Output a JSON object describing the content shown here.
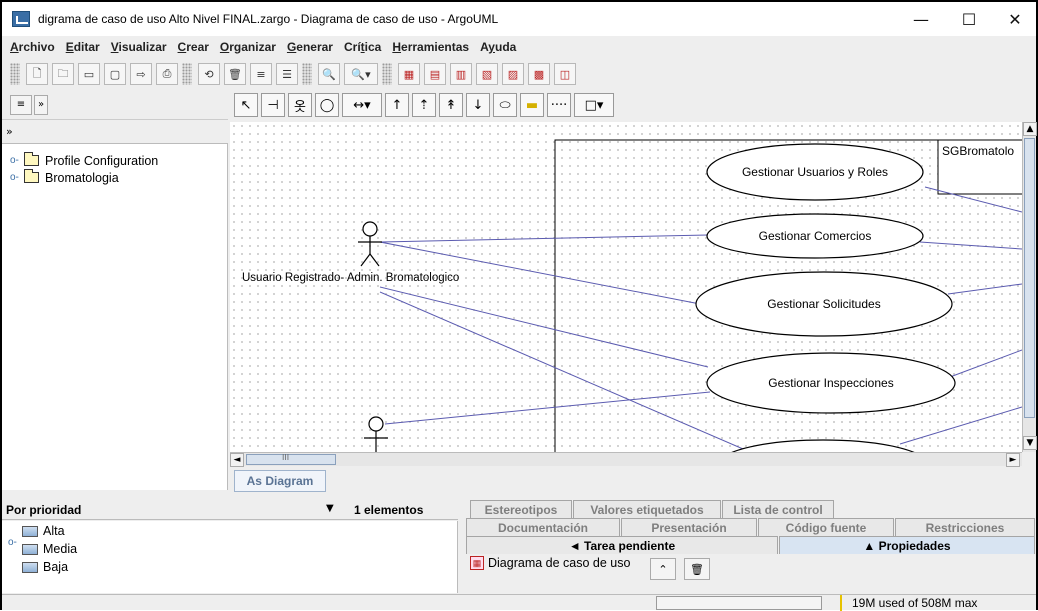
{
  "window": {
    "title": "digrama de caso de uso Alto Nivel FINAL.zargo - Diagrama de caso de uso - ArgoUML",
    "minimize": "—",
    "maximize": "☐",
    "close": "✕"
  },
  "menu": [
    {
      "label": "Archivo",
      "mnemonic": "A"
    },
    {
      "label": "Editar",
      "mnemonic": "E"
    },
    {
      "label": "Visualizar",
      "mnemonic": "V"
    },
    {
      "label": "Crear",
      "mnemonic": "C"
    },
    {
      "label": "Organizar",
      "mnemonic": "O"
    },
    {
      "label": "Generar",
      "mnemonic": "G"
    },
    {
      "label": "Crítica",
      "mnemonic": "t"
    },
    {
      "label": "Herramientas",
      "mnemonic": "H"
    },
    {
      "label": "Ayuda",
      "mnemonic": "y"
    }
  ],
  "explorer": {
    "expand_glyph": "»",
    "tree": [
      {
        "label": "Profile Configuration"
      },
      {
        "label": "Bromatologia"
      }
    ]
  },
  "diagram": {
    "tab_label": "As Diagram",
    "system_name": "SGBromatolo",
    "actors": [
      {
        "label": "Usuario Registrado- Admin. Bromatologico"
      },
      {
        "label": ""
      }
    ],
    "use_cases": [
      {
        "label": "Gestionar Usuarios y Roles"
      },
      {
        "label": "Gestionar Comercios"
      },
      {
        "label": "Gestionar Solicitudes"
      },
      {
        "label": "Gestionar Inspecciones"
      },
      {
        "label": ""
      }
    ],
    "scroll_mark": "III"
  },
  "todo": {
    "sort_label": "Por prioridad",
    "count_label": "1 elementos",
    "priorities": [
      "Alta",
      "Media",
      "Baja"
    ]
  },
  "detail_tabs": {
    "row1": [
      "Estereotipos",
      "Valores etiquetados",
      "Lista de control"
    ],
    "row2": [
      "Documentación",
      "Presentación",
      "Código fuente",
      "Restricciones"
    ],
    "row3": [
      "◄ Tarea pendiente",
      "▲ Propiedades"
    ],
    "selected_item": "Diagrama de caso de uso"
  },
  "status": {
    "memory": "19M used of 508M max"
  }
}
